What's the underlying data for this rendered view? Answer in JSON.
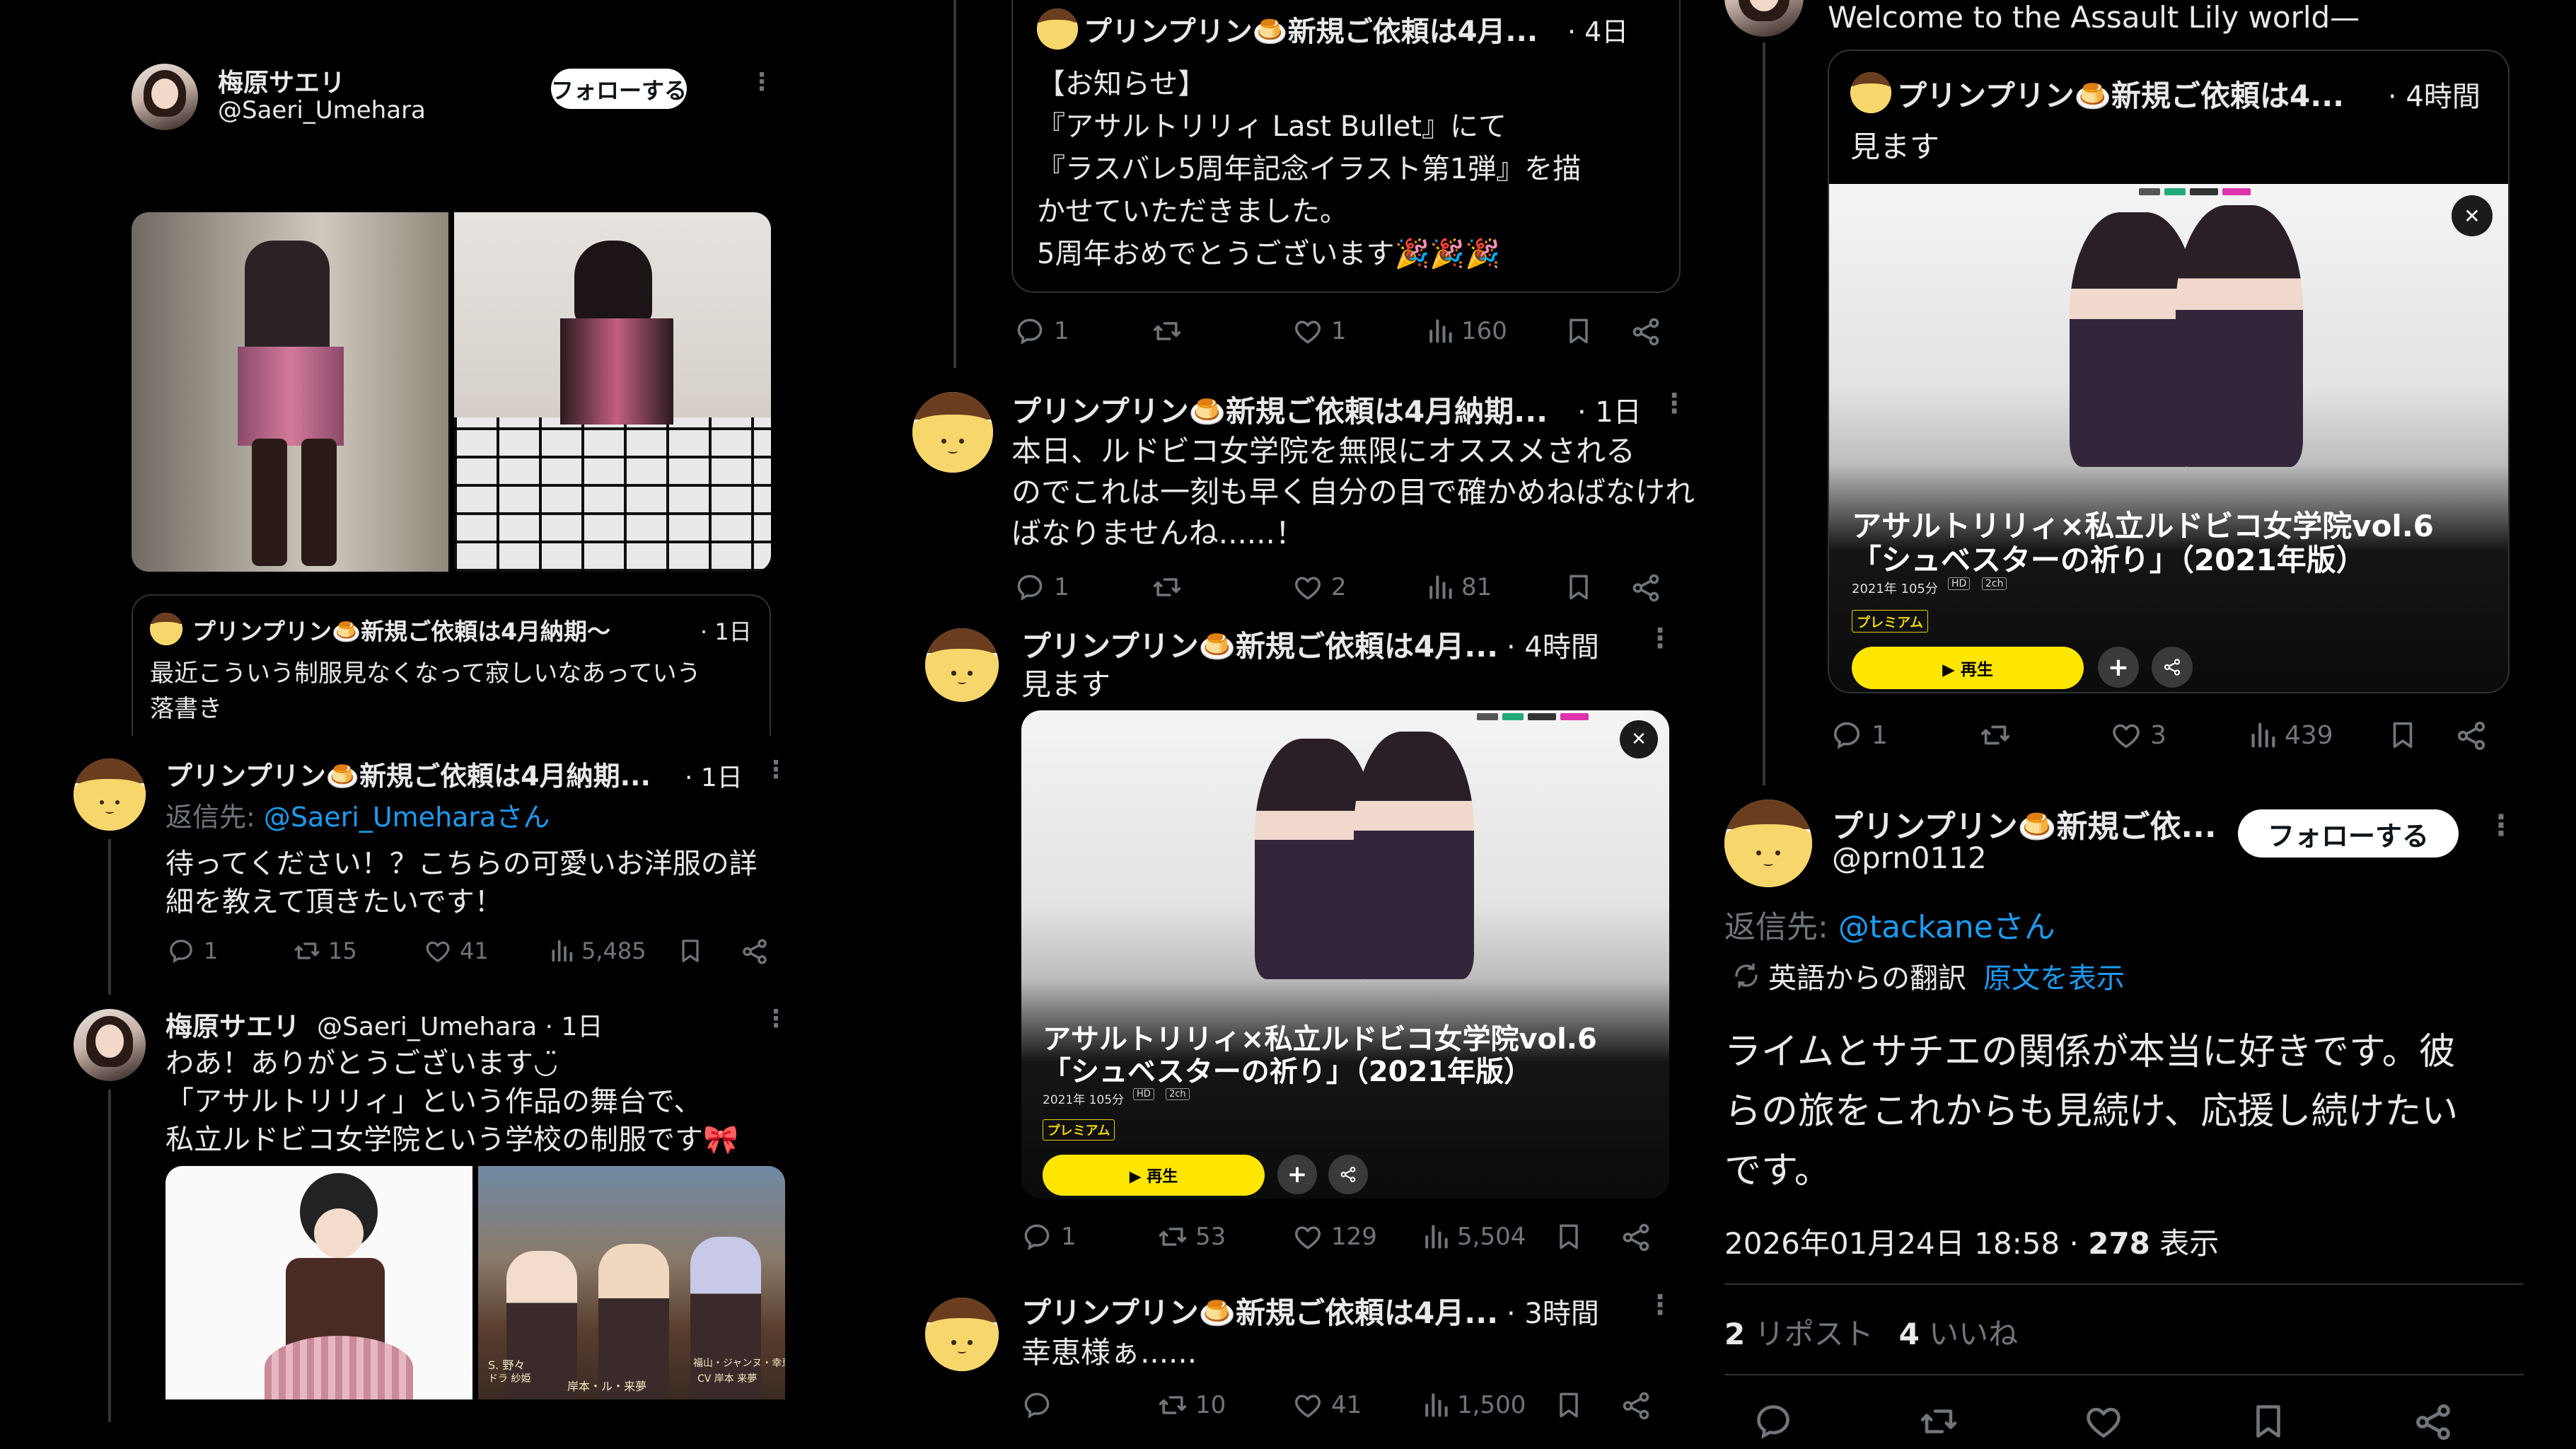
{
  "left": {
    "profile": {
      "name": "梅原サエリ",
      "handle": "@Saeri_Umehara",
      "follow_label": "フォローする"
    },
    "quote": {
      "author": "プリンプリン🍮新規ご依頼は4月納期〜",
      "time": "· 1日",
      "text_lines": [
        "最近こういう制服見なくなって寂しいなあっていう",
        "落書き"
      ]
    },
    "reply1": {
      "author": "プリンプリン🍮新規ご依頼は4月納期...",
      "time": "· 1日",
      "reply_prefix": "返信先: ",
      "reply_to": "@Saeri_Umeharaさん",
      "text_lines": [
        "待ってください！？こちらの可愛いお洋服の詳",
        "細を教えて頂きたいです！"
      ],
      "replies": "1",
      "reposts": "15",
      "likes": "41",
      "views": "5,485"
    },
    "reply2": {
      "author": "梅原サエリ",
      "handle_time": "@Saeri_Umehara · 1日",
      "text_lines": [
        "わあ！ありがとうございます◡̈",
        "「アサルトリリィ」という作品の舞台で、",
        "私立ルドビコ女学院という学校の制服です🎀"
      ],
      "img_captions": [
        "S. 野々",
        "ドラ 紗姫",
        "岸本・ル・来夢",
        "福山・ジャンヌ・幸恵",
        "CV 岸本 来夢"
      ]
    }
  },
  "middle": {
    "post1": {
      "author": "プリンプリン🍮新規ご依頼は4月...",
      "time": "· 4日",
      "text_lines": [
        "【お知らせ】",
        "『アサルトリリィ Last Bullet』にて",
        "『ラスバレ5周年記念イラスト第1弾』を描",
        "かせていただきました。",
        "5周年おめでとうございます🎉🎉🎉"
      ],
      "replies": "1",
      "reposts": "",
      "likes": "1",
      "views": "160"
    },
    "post2": {
      "author": "プリンプリン🍮新規ご依頼は4月納期...",
      "time": "· 1日",
      "text_lines": [
        "本日、ルドビコ女学院を無限にオススメされる",
        "のでこれは一刻も早く自分の目で確かめねばなけれ",
        "ばなりませんね......！"
      ],
      "replies": "1",
      "reposts": "",
      "likes": "2",
      "views": "81"
    },
    "post3": {
      "author": "プリンプリン🍮新規ご依頼は4月...",
      "time": "· 4時間",
      "text": "見ます",
      "replies": "1",
      "reposts": "53",
      "likes": "129",
      "views": "5,504"
    },
    "post4": {
      "author": "プリンプリン🍮新規ご依頼は4月...",
      "time": "· 3時間",
      "text": "幸恵様ぁ......",
      "replies": "",
      "reposts": "10",
      "likes": "41",
      "views": "1,500"
    }
  },
  "video": {
    "title_line1": "アサルトリリィ×私立ルドビコ女学院vol.6",
    "title_line2": "「シュベスターの祈り」（2021年版）",
    "meta": "2021年 105分",
    "hd": "HD",
    "ch": "2ch",
    "premium": "プレミアム",
    "play": "▶ 再生",
    "plus": "+",
    "close": "✕"
  },
  "right": {
    "top_text": "Welcome to the Assault Lily world—",
    "quote": {
      "author": "プリンプリン🍮新規ご依頼は4...",
      "time": "· 4時間",
      "text": "見ます",
      "replies": "1",
      "reposts": "",
      "likes": "3",
      "views": "439"
    },
    "main": {
      "name": "プリンプリン🍮新規ご依...",
      "handle": "@prn0112",
      "follow_label": "フォローする",
      "reply_prefix": "返信先: ",
      "reply_to": "@tackaneさん",
      "translation_label": "英語からの翻訳",
      "show_original": "原文を表示",
      "text_lines": [
        "ライムとサチエの関係が本当に好きです。彼",
        "らの旅をこれからも見続け、応援し続けたい",
        "です。"
      ],
      "timestamp": "2026年01月24日 18:58 · ",
      "views_count": "278",
      "views_label": " 表示",
      "reposts_count": "2",
      "reposts_label": " リポスト",
      "likes_count": "4",
      "likes_label": " いいね"
    }
  },
  "icons": [
    "reply-icon",
    "repost-icon",
    "like-icon",
    "views-icon",
    "bookmark-icon",
    "share-icon",
    "more-icon",
    "close-icon",
    "translate-icon"
  ],
  "colors": {
    "background": "#000000",
    "text": "#e7e9ea",
    "muted": "#71767b",
    "link": "#1d9bf0",
    "divider": "#2f3336",
    "premium_yellow": "#ffe600"
  }
}
